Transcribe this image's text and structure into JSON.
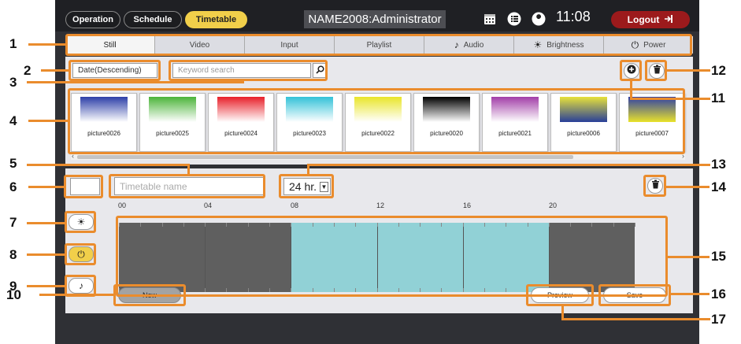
{
  "topbar": {
    "modes": [
      "Operation",
      "Schedule",
      "Timetable"
    ],
    "title": "NAME2008:Administrator",
    "time": "11:08",
    "logout_label": "Logout",
    "icons": [
      "calendar-icon",
      "list-icon",
      "wrench-icon",
      "logout-icon"
    ]
  },
  "tabs": [
    {
      "label": "Still",
      "icon": ""
    },
    {
      "label": "Video",
      "icon": ""
    },
    {
      "label": "Input",
      "icon": ""
    },
    {
      "label": "Playlist",
      "icon": ""
    },
    {
      "label": "Audio",
      "icon": "music-note-icon"
    },
    {
      "label": "Brightness",
      "icon": "sun-icon"
    },
    {
      "label": "Power",
      "icon": "power-icon"
    }
  ],
  "library": {
    "sort_value": "Date(Descending)",
    "search_placeholder": "Keyword search",
    "pictures": [
      {
        "name": "picture0026",
        "colors": [
          "#2d3fa8",
          "#ffffff"
        ]
      },
      {
        "name": "picture0025",
        "colors": [
          "#4cb43a",
          "#ffffff"
        ]
      },
      {
        "name": "picture0024",
        "colors": [
          "#e8202a",
          "#ffffff"
        ]
      },
      {
        "name": "picture0023",
        "colors": [
          "#33c2d8",
          "#ffffff"
        ]
      },
      {
        "name": "picture0022",
        "colors": [
          "#e9e52a",
          "#ffffff"
        ]
      },
      {
        "name": "picture0020",
        "colors": [
          "#000000",
          "#ffffff"
        ]
      },
      {
        "name": "picture0021",
        "colors": [
          "#a23ea8",
          "#ffffff"
        ]
      },
      {
        "name": "picture0006",
        "colors": [
          "#e8e23a",
          "#283f9a"
        ]
      },
      {
        "name": "picture0007",
        "colors": [
          "#2d3fa8",
          "#e9e22a"
        ]
      }
    ]
  },
  "timetable": {
    "name_placeholder": "Timetable name",
    "span_value": "24 hr.",
    "hours": [
      "00",
      "04",
      "08",
      "12",
      "16",
      "20"
    ],
    "segments": [
      {
        "from_hour": 0,
        "to_hour": 8,
        "color": "#5f5f5f"
      },
      {
        "from_hour": 8,
        "to_hour": 20,
        "color": "#91d1d6"
      },
      {
        "from_hour": 20,
        "to_hour": 24,
        "color": "#5f5f5f"
      }
    ],
    "new_label": "New",
    "preview_label": "Preview",
    "save_label": "Save"
  },
  "callouts": [
    "1",
    "2",
    "3",
    "4",
    "5",
    "6",
    "7",
    "8",
    "9",
    "10",
    "11",
    "12",
    "13",
    "14",
    "15",
    "16",
    "17"
  ],
  "accent_color": "#ea8c2d"
}
